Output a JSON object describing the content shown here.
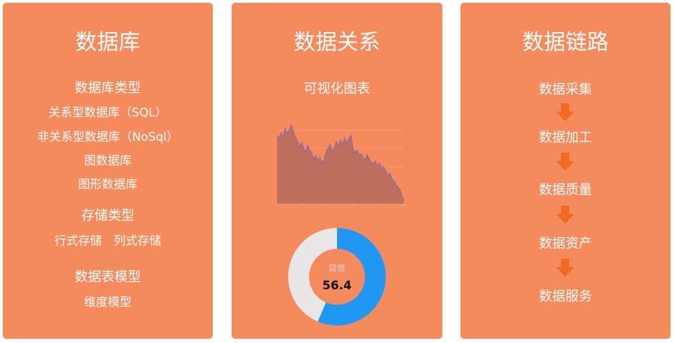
{
  "colors": {
    "card": "#f58a5d",
    "arrow": "#f26a1f",
    "donut_filled": "#2196f3",
    "donut_rest": "#e8e6e6",
    "area": "#b6695d"
  },
  "card1": {
    "title": "数据库",
    "section1": "数据库类型",
    "items": [
      "关系型数据库（SQL）",
      "非关系型数据库（NoSql）",
      "图数据库",
      "图形数据库"
    ],
    "section2": "存储类型",
    "storage": "行式存储　列式存储",
    "section3": "数据表模型",
    "model": "维度模型"
  },
  "card2": {
    "title": "数据关系",
    "subtitle": "可视化图表",
    "donut": {
      "label": "异常",
      "value": "56.4",
      "percent": 56.4
    }
  },
  "card3": {
    "title": "数据链路",
    "steps": [
      "数据采集",
      "数据加工",
      "数据质量",
      "数据资产",
      "数据服务"
    ],
    "arrow_icon": "down-arrow-icon"
  },
  "chart_data": {
    "type": "area",
    "ylim": [
      0,
      100
    ],
    "values": [
      74,
      70,
      77,
      72,
      82,
      76,
      80,
      85,
      78,
      72,
      68,
      62,
      66,
      60,
      56,
      63,
      58,
      54,
      48,
      52,
      46,
      50,
      44,
      47,
      56,
      60,
      64,
      57,
      61,
      67,
      63,
      69,
      64,
      71,
      66,
      70,
      74,
      61,
      55,
      58,
      52,
      54,
      50,
      47,
      53,
      48,
      45,
      43,
      46,
      41,
      44,
      38,
      40,
      36,
      30,
      33,
      27,
      25,
      21,
      18,
      15,
      8,
      4
    ]
  }
}
